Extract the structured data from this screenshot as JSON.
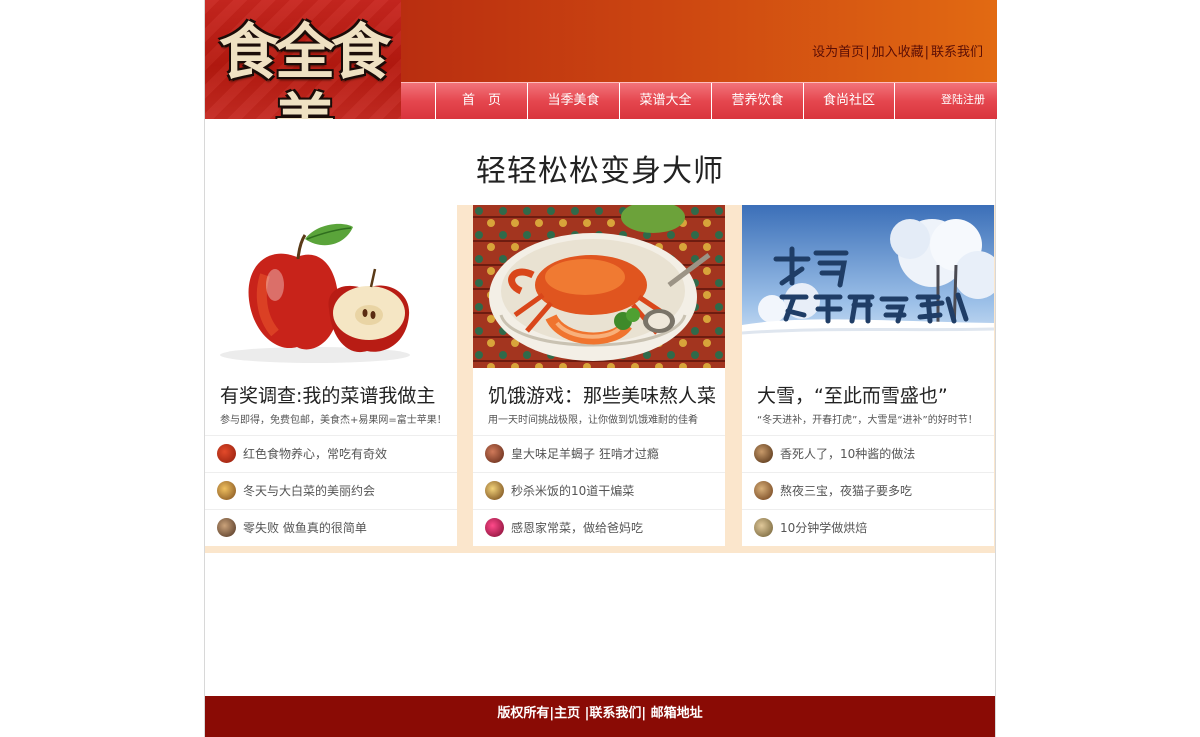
{
  "logo": {
    "text": "食全食美"
  },
  "top_links": [
    "设为首页",
    "加入收藏",
    "联系我们"
  ],
  "top_sep": "|",
  "nav": {
    "items": [
      "首　页",
      "当季美食",
      "菜谱大全",
      "营养饮食",
      "食尚社区"
    ],
    "login": "登陆注册"
  },
  "headline": "轻轻松松变身大师",
  "cards": [
    {
      "title": "有奖调查:我的菜谱我做主",
      "subtitle": "参与即得，免费包邮，美食杰+易果网=富士苹果！",
      "items": [
        "红色食物养心，常吃有奇效",
        "冬天与大白菜的美丽约会",
        "零失败 做鱼真的很简单"
      ]
    },
    {
      "title": "饥饿游戏：那些美味熬人菜",
      "subtitle": "用一天时间挑战极限，让你做到饥饿难耐的佳肴",
      "items": [
        "皇大味足羊蝎子 狂啃才过瘾",
        "秒杀米饭的10道干煸菜",
        "感恩家常菜，做给爸妈吃"
      ]
    },
    {
      "title": "大雪，“至此而雪盛也”",
      "subtitle": "“冬天进补，开春打虎”，大雪是“进补”的好时节！",
      "image_text": "大雪，至此而雪盛也",
      "items": [
        "香死人了，10种酱的做法",
        "熬夜三宝，夜猫子要多吃",
        "10分钟学做烘焙"
      ]
    }
  ],
  "footer": {
    "links": [
      "版权所有",
      "主页",
      "联系我们",
      "邮箱地址"
    ],
    "sep": "|"
  },
  "colors": {
    "footer_bg": "#8a0b05",
    "nav_bg": "#e5474f",
    "topbar": "#cc4611",
    "card_strip": "#fbe6cc"
  }
}
